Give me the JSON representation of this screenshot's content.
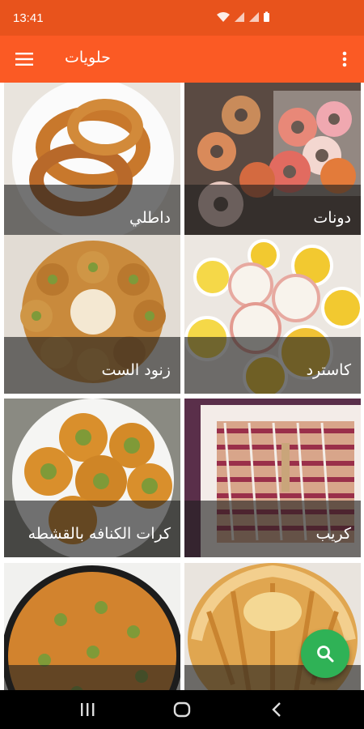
{
  "status_bar": {
    "time": "13:41"
  },
  "app_bar": {
    "title": "حلويات"
  },
  "recipes": [
    {
      "name": "دونات"
    },
    {
      "name": "داطلي"
    },
    {
      "name": "كاسترد"
    },
    {
      "name": "زنود الست"
    },
    {
      "name": "كريب"
    },
    {
      "name": "كرات الكنافه بالقشطه"
    },
    {
      "name": ""
    },
    {
      "name": ""
    }
  ],
  "colors": {
    "status_bar": "#e8531c",
    "app_bar": "#fb5a24",
    "fab": "#2fb256",
    "caption_overlay": "rgba(30,30,30,0.62)"
  },
  "icons": {
    "menu": "hamburger-icon",
    "more": "more-vertical-icon",
    "fab": "search-icon",
    "nav_recent": "recent-apps-icon",
    "nav_home": "home-icon",
    "nav_back": "back-icon"
  }
}
